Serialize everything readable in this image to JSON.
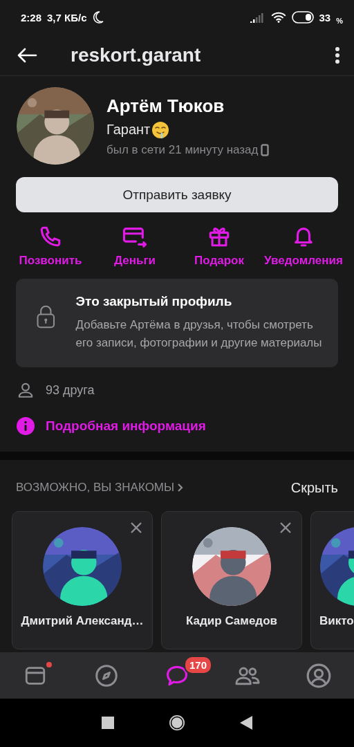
{
  "status_bar": {
    "time": "2:28",
    "speed": "3,7 КБ/с",
    "battery": "33",
    "battery_unit": "%"
  },
  "header": {
    "title": "reskort.garant"
  },
  "profile": {
    "name": "Артём Тюков",
    "status": "Гарант",
    "last_seen": "был в сети 21 минуту назад"
  },
  "primary_button": "Отправить заявку",
  "actions": [
    {
      "kind": "phone",
      "label": "Позвонить"
    },
    {
      "kind": "money",
      "label": "Деньги"
    },
    {
      "kind": "gift",
      "label": "Подарок"
    },
    {
      "kind": "bell",
      "label": "Уведомления"
    }
  ],
  "closed_profile": {
    "title": "Это закрытый профиль",
    "text": "Добавьте Артёма в друзья, чтобы смотреть его записи, фотографии и другие материалы"
  },
  "friends": "93 друга",
  "details_link": "Подробная информация",
  "suggestions": {
    "title": "ВОЗМОЖНО, ВЫ ЗНАКОМЫ",
    "hide": "Скрыть",
    "people": [
      {
        "kind": "full",
        "name": "Дмитрий Александ…"
      },
      {
        "kind": "full",
        "name": "Кадир Самедов"
      },
      {
        "kind": "partial",
        "name": "Викто"
      }
    ]
  },
  "tab_bar": [
    {
      "kind": "feed",
      "selected": false,
      "dot": true
    },
    {
      "kind": "explore",
      "selected": false,
      "dot": false
    },
    {
      "kind": "messages",
      "selected": true,
      "dot": false,
      "badge": "170"
    },
    {
      "kind": "friends",
      "selected": false,
      "dot": false
    },
    {
      "kind": "profile",
      "selected": false,
      "dot": false
    }
  ]
}
